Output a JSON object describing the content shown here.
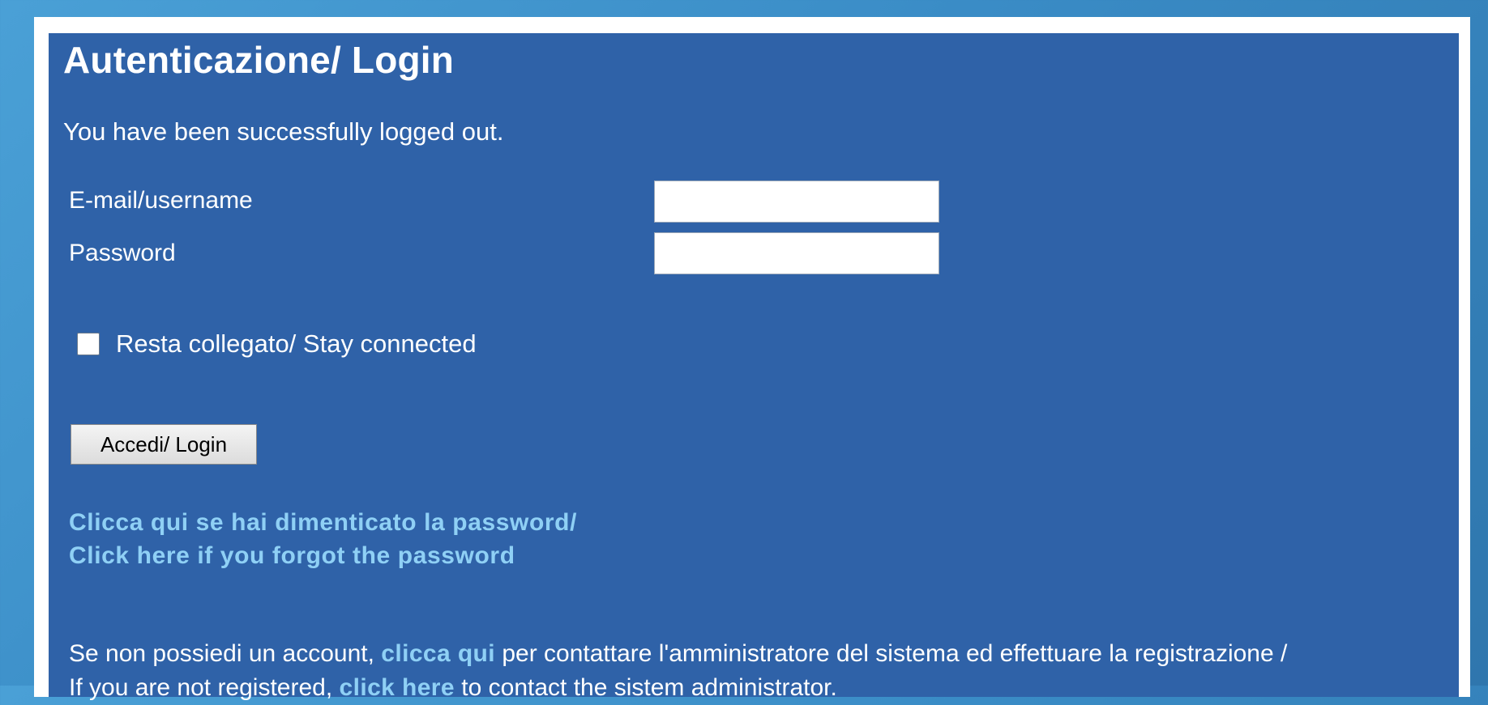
{
  "login": {
    "title": "Autenticazione/ Login",
    "status_message": "You have been successfully logged out.",
    "email_label": "E-mail/username",
    "email_value": "",
    "password_label": "Password",
    "password_value": "",
    "stay_connected_label": "Resta collegato/ Stay connected",
    "stay_connected_checked": false,
    "login_button_label": "Accedi/ Login",
    "forgot_password_line1": "Clicca qui se hai dimenticato la password/",
    "forgot_password_line2": "Click here if you forgot the password",
    "register": {
      "it_prefix": "Se non possiedi un account, ",
      "it_link": "clicca qui",
      "it_suffix": " per contattare l'amministratore del sistema ed effettuare la registrazione /",
      "en_prefix": "If you are not registered, ",
      "en_link": "click here",
      "en_suffix": " to contact the sistem administrator."
    }
  },
  "colors": {
    "panel_background": "#2f62a8",
    "link": "#8fd0f5",
    "page_background": "#3a8cc6"
  }
}
